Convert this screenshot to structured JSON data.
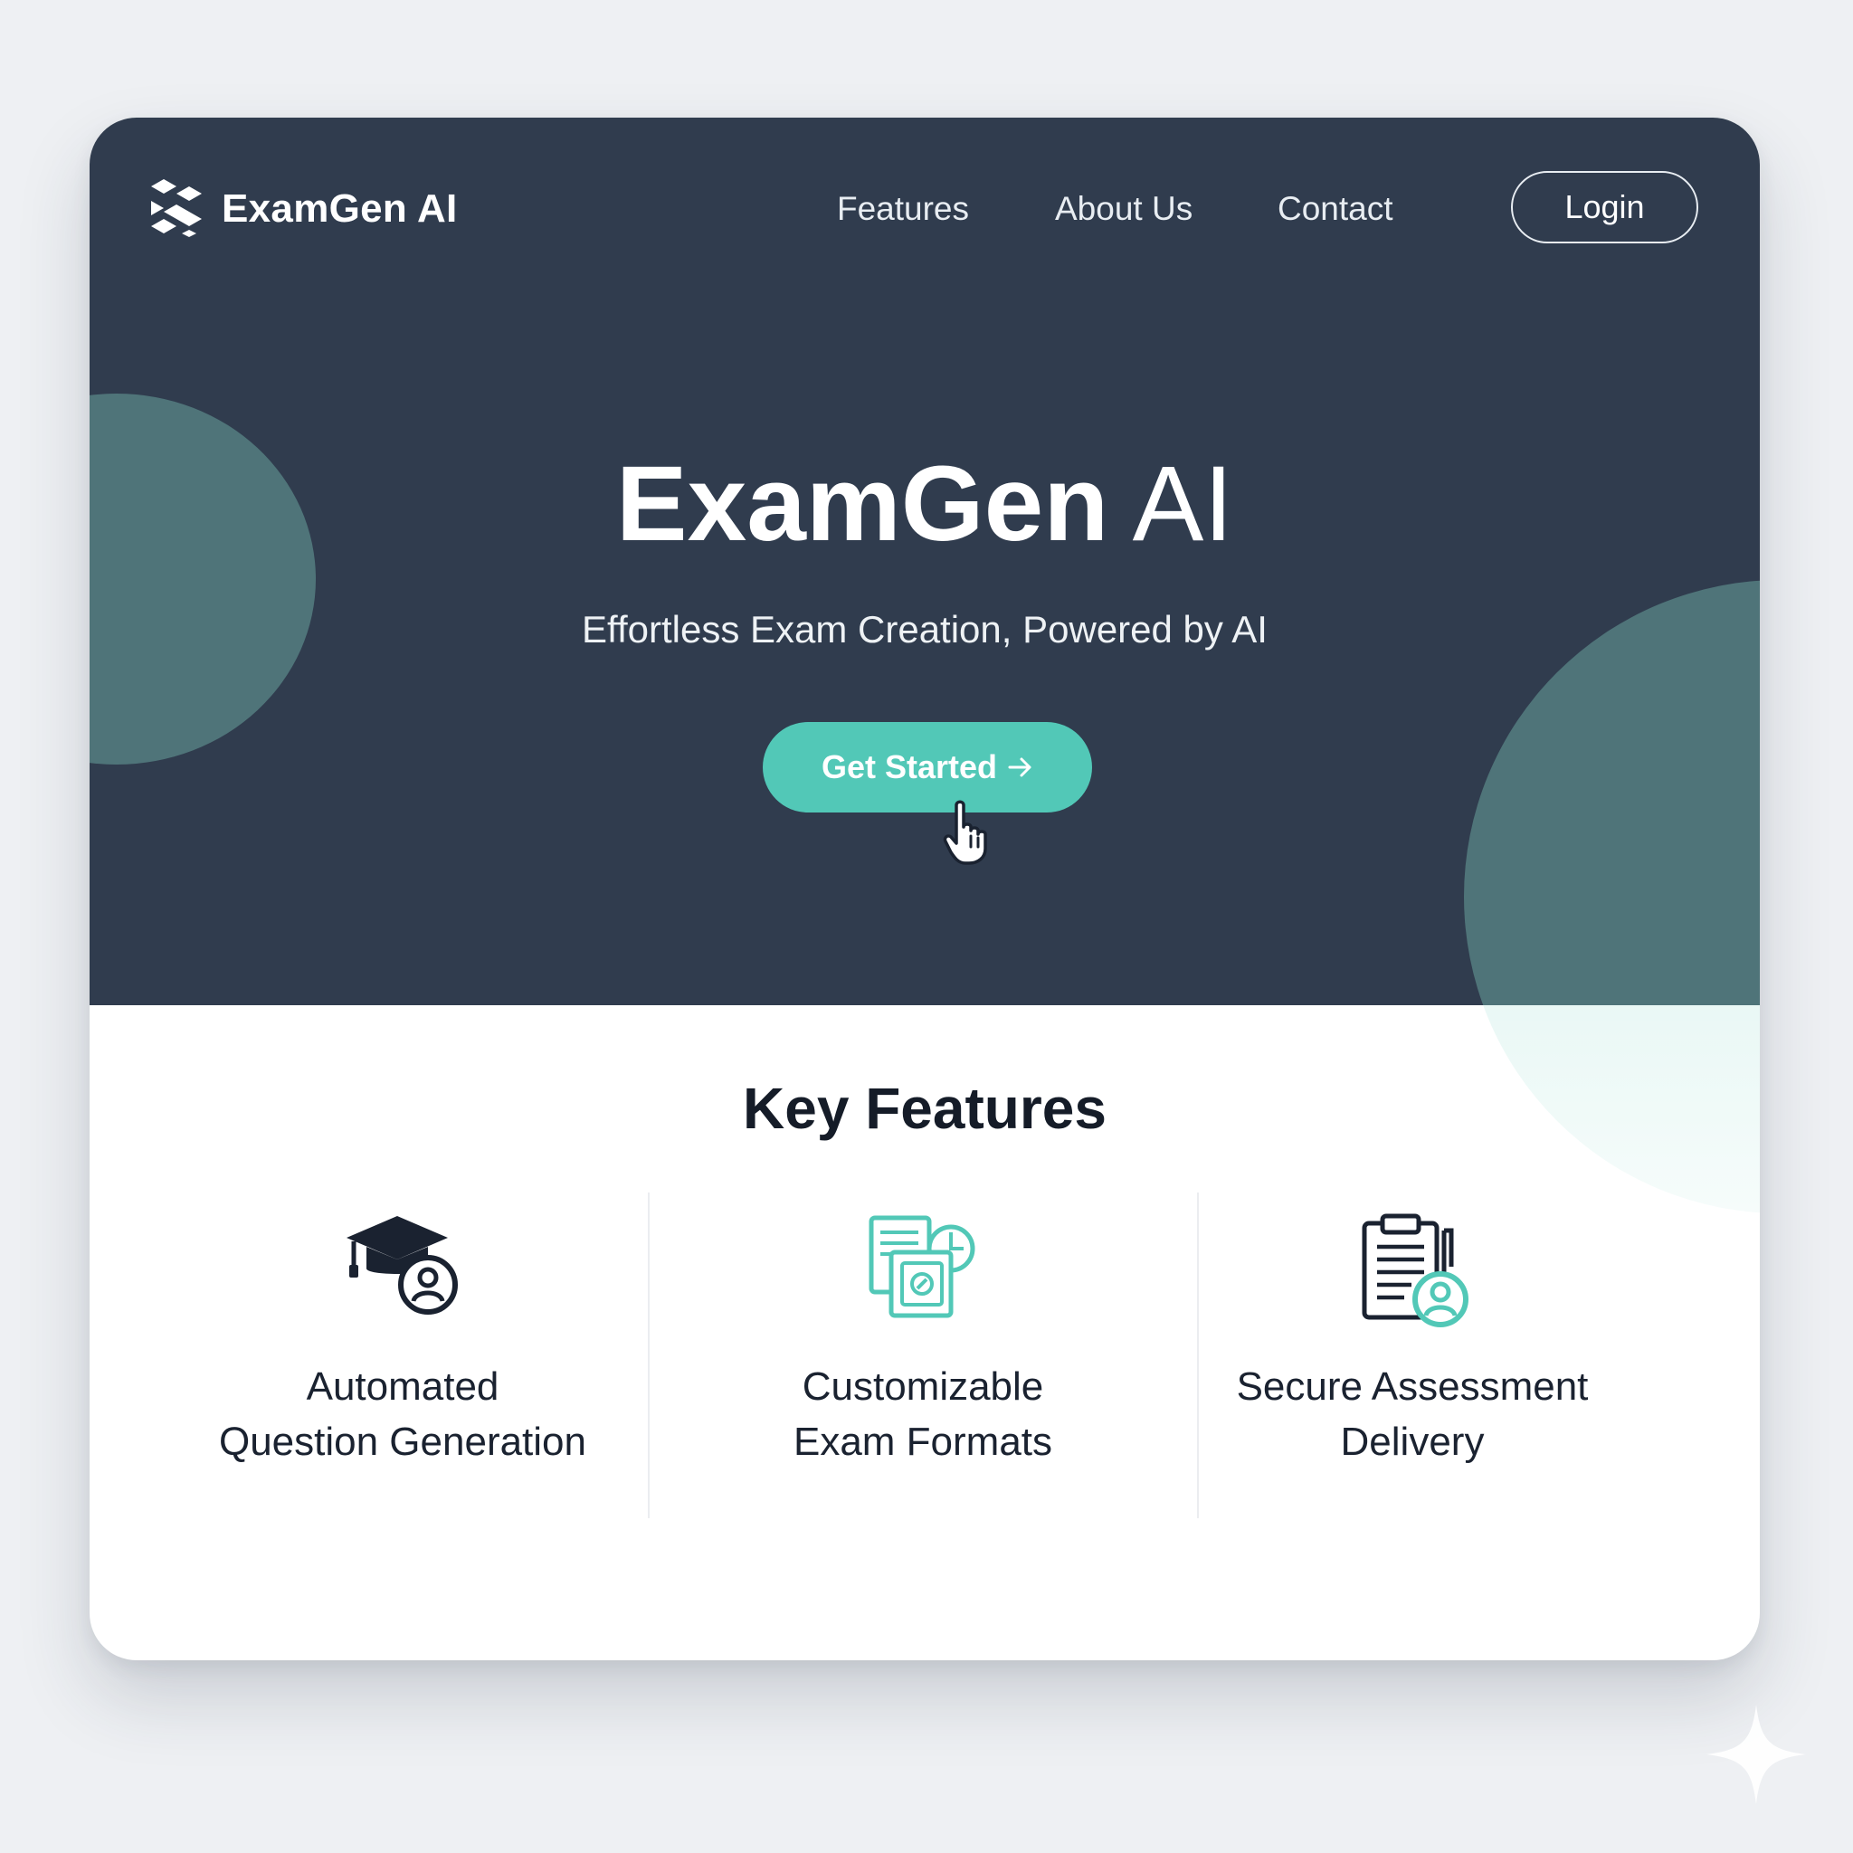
{
  "brand": {
    "name": "ExamGen AI",
    "icon": "examgen-logo-icon"
  },
  "nav": {
    "links": [
      "Features",
      "About Us",
      "Contact"
    ],
    "login_label": "Login"
  },
  "hero": {
    "title_bold": "ExamGen",
    "title_light": "AI",
    "subtitle": "Effortless Exam Creation, Powered by AI",
    "cta_label": "Get Started",
    "cta_icon": "arrow-right-icon"
  },
  "features": {
    "title": "Key Features",
    "items": [
      {
        "label": "Automated\nQuestion Generation",
        "icon": "graduation-cap-user-icon"
      },
      {
        "label": "Customizable\nExam Formats",
        "icon": "document-layers-icon"
      },
      {
        "label": "Secure Assessment\nDelivery",
        "icon": "clipboard-user-icon"
      }
    ]
  },
  "colors": {
    "hero_bg": "#303c4e",
    "accent": "#52c8b7",
    "blob": "#4f7479",
    "page_bg": "#eef0f3"
  }
}
